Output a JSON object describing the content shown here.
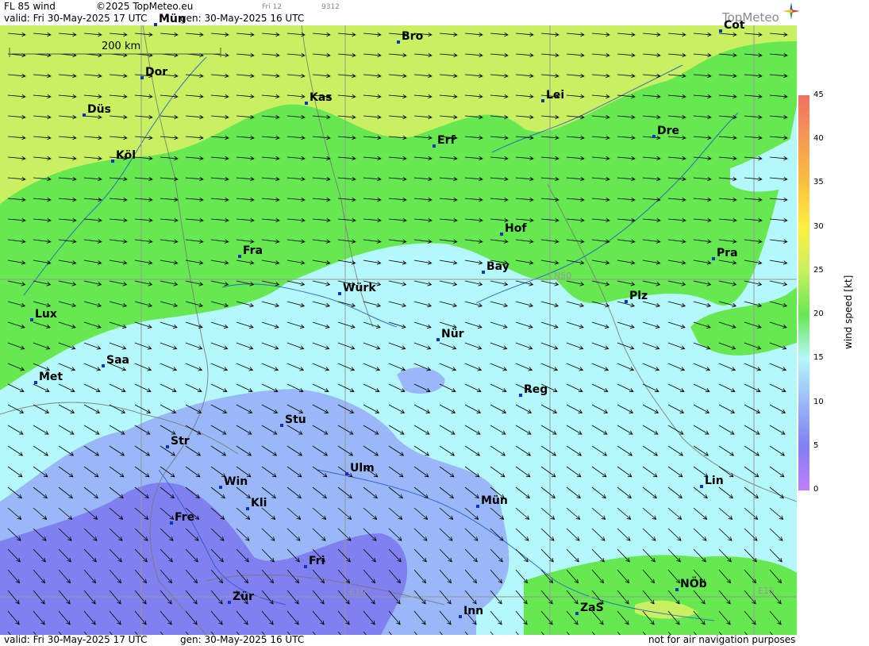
{
  "header": {
    "product": "FL 85 wind",
    "copyright": "©2025 TopMeteo.eu",
    "valid": "valid:  Fri  30-May-2025  17 UTC",
    "gen": "gen: 30-May-2025 16 UTC",
    "small_a": "Fri 12",
    "small_b": "9312",
    "logo": "TopMeteo"
  },
  "footer": {
    "valid": "valid:  Fri  30-May-2025  17 UTC",
    "gen": "gen: 30-May-2025 16 UTC",
    "notice": "not for air navigation purposes"
  },
  "map": {
    "scale_label": "200 km",
    "grid_labels": [
      "N50",
      "E10",
      "E15"
    ],
    "cities": [
      {
        "name": "Mün"
      },
      {
        "name": "Bro"
      },
      {
        "name": "Cot"
      },
      {
        "name": "Dor"
      },
      {
        "name": "Kas"
      },
      {
        "name": "Lei"
      },
      {
        "name": "Düs"
      },
      {
        "name": "Erf"
      },
      {
        "name": "Dre"
      },
      {
        "name": "Köl"
      },
      {
        "name": "Hof"
      },
      {
        "name": "Fra"
      },
      {
        "name": "Pra"
      },
      {
        "name": "Bay"
      },
      {
        "name": "Würk"
      },
      {
        "name": "Plz"
      },
      {
        "name": "Lux"
      },
      {
        "name": "Nür"
      },
      {
        "name": "Saa"
      },
      {
        "name": "Met"
      },
      {
        "name": "Reg"
      },
      {
        "name": "Stu"
      },
      {
        "name": "Str"
      },
      {
        "name": "Ulm"
      },
      {
        "name": "Win"
      },
      {
        "name": "Lin"
      },
      {
        "name": "Kli"
      },
      {
        "name": "Mün"
      },
      {
        "name": "Fre"
      },
      {
        "name": "Fri"
      },
      {
        "name": "NÖb"
      },
      {
        "name": "Zür"
      },
      {
        "name": "ZaS"
      },
      {
        "name": "Inn"
      }
    ]
  },
  "legend": {
    "unit": "wind speed [kt]",
    "ticks": [
      "45",
      "40",
      "35",
      "30",
      "25",
      "20",
      "15",
      "10",
      "5",
      "0"
    ],
    "colors": [
      "#f07060",
      "#f59a55",
      "#f9c040",
      "#fdf040",
      "#c8f060",
      "#66e850",
      "#b4f8fb",
      "#9ab8f8",
      "#8080f0",
      "#c080f8"
    ]
  }
}
